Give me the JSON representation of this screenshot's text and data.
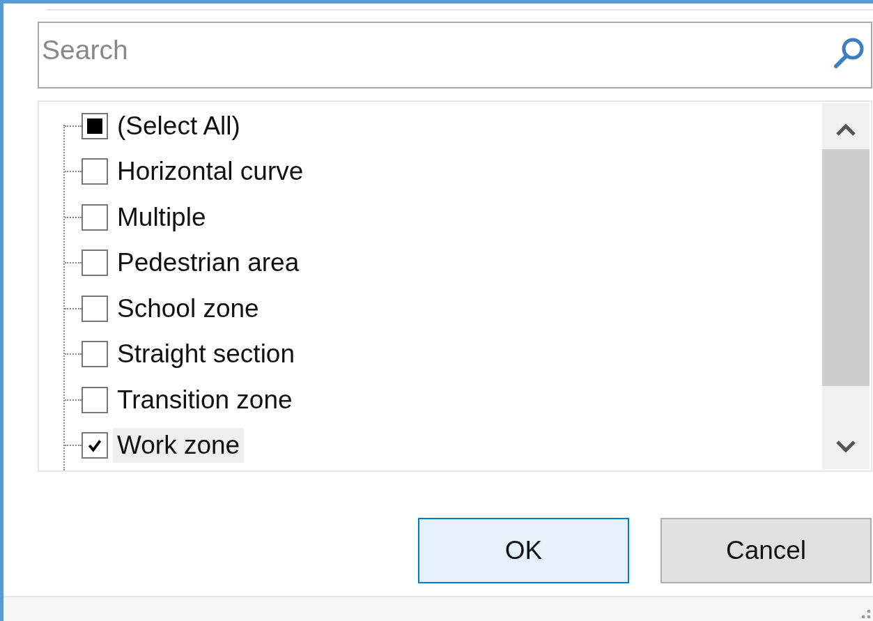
{
  "search": {
    "placeholder": "Search"
  },
  "items": [
    {
      "label": "(Select All)",
      "checked": false,
      "indeterminate": true,
      "selected": false
    },
    {
      "label": "Horizontal curve",
      "checked": false,
      "indeterminate": false,
      "selected": false
    },
    {
      "label": "Multiple",
      "checked": false,
      "indeterminate": false,
      "selected": false
    },
    {
      "label": "Pedestrian area",
      "checked": false,
      "indeterminate": false,
      "selected": false
    },
    {
      "label": "School zone",
      "checked": false,
      "indeterminate": false,
      "selected": false
    },
    {
      "label": "Straight section",
      "checked": false,
      "indeterminate": false,
      "selected": false
    },
    {
      "label": "Transition zone",
      "checked": false,
      "indeterminate": false,
      "selected": false
    },
    {
      "label": "Work zone",
      "checked": true,
      "indeterminate": false,
      "selected": true
    }
  ],
  "buttons": [
    {
      "label": "OK",
      "kind": "default"
    },
    {
      "label": "Cancel",
      "kind": "normal"
    }
  ]
}
